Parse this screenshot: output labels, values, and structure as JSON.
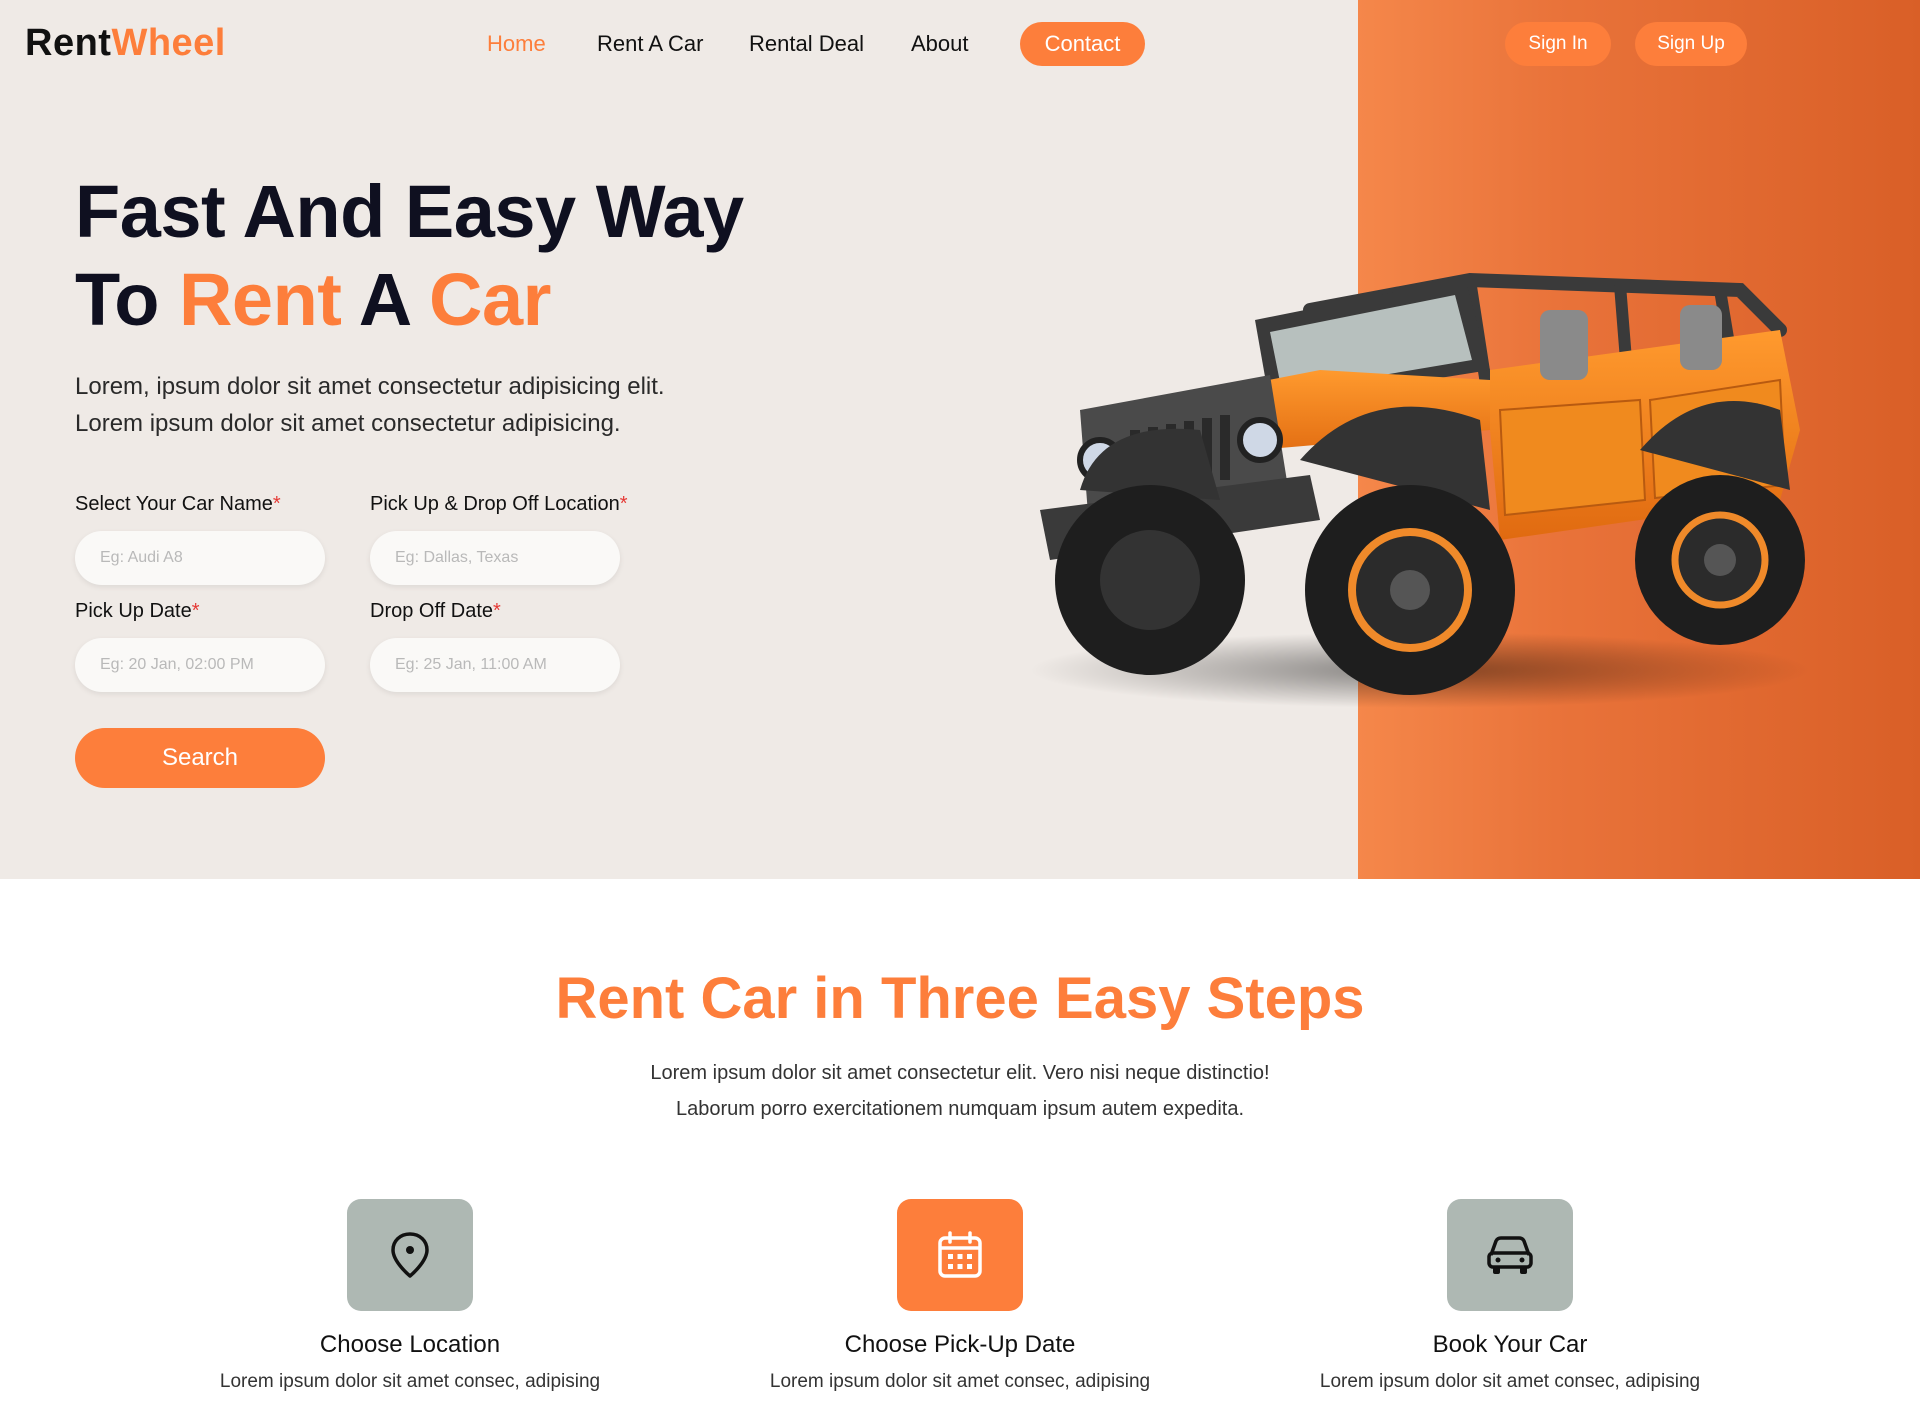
{
  "brand": {
    "part1": "Rent",
    "part2": "Wheel"
  },
  "nav": {
    "home": "Home",
    "rent": "Rent A Car",
    "deal": "Rental Deal",
    "about": "About",
    "contact": "Contact"
  },
  "auth": {
    "signin": "Sign In",
    "signup": "Sign Up"
  },
  "hero": {
    "line1": "Fast And Easy Way",
    "line2_a": "To ",
    "line2_b": "Rent",
    "line2_c": " A ",
    "line2_d": "Car",
    "subtitle_1": "Lorem, ipsum dolor sit amet consectetur adipisicing elit.",
    "subtitle_2": "Lorem ipsum dolor sit amet consectetur adipisicing."
  },
  "form": {
    "car_name_label": "Select Your Car Name",
    "car_name_placeholder": "Eg: Audi A8",
    "location_label": "Pick Up & Drop Off Location",
    "location_placeholder": "Eg: Dallas, Texas",
    "pickup_label": "Pick Up Date",
    "pickup_placeholder": "Eg: 20 Jan, 02:00 PM",
    "dropoff_label": "Drop Off Date",
    "dropoff_placeholder": "Eg: 25 Jan, 11:00 AM",
    "required_mark": "*",
    "search": "Search"
  },
  "steps": {
    "title": "Rent Car in Three Easy Steps",
    "subtitle_1": "Lorem ipsum dolor sit amet consectetur elit. Vero nisi neque distinctio!",
    "subtitle_2": "Laborum porro exercitationem numquam ipsum autem expedita.",
    "items": [
      {
        "title": "Choose Location",
        "text": "Lorem ipsum dolor sit amet consec, adipising",
        "icon": "map-pin-icon"
      },
      {
        "title": "Choose Pick-Up Date",
        "text": "Lorem ipsum dolor sit amet consec, adipising",
        "icon": "calendar-icon"
      },
      {
        "title": "Book Your Car",
        "text": "Lorem ipsum dolor sit amet consec, adipising",
        "icon": "car-icon"
      }
    ]
  },
  "colors": {
    "accent": "#fd7e3b",
    "hero_bg": "#efeae6",
    "icon_grey": "#aeb8b3"
  }
}
